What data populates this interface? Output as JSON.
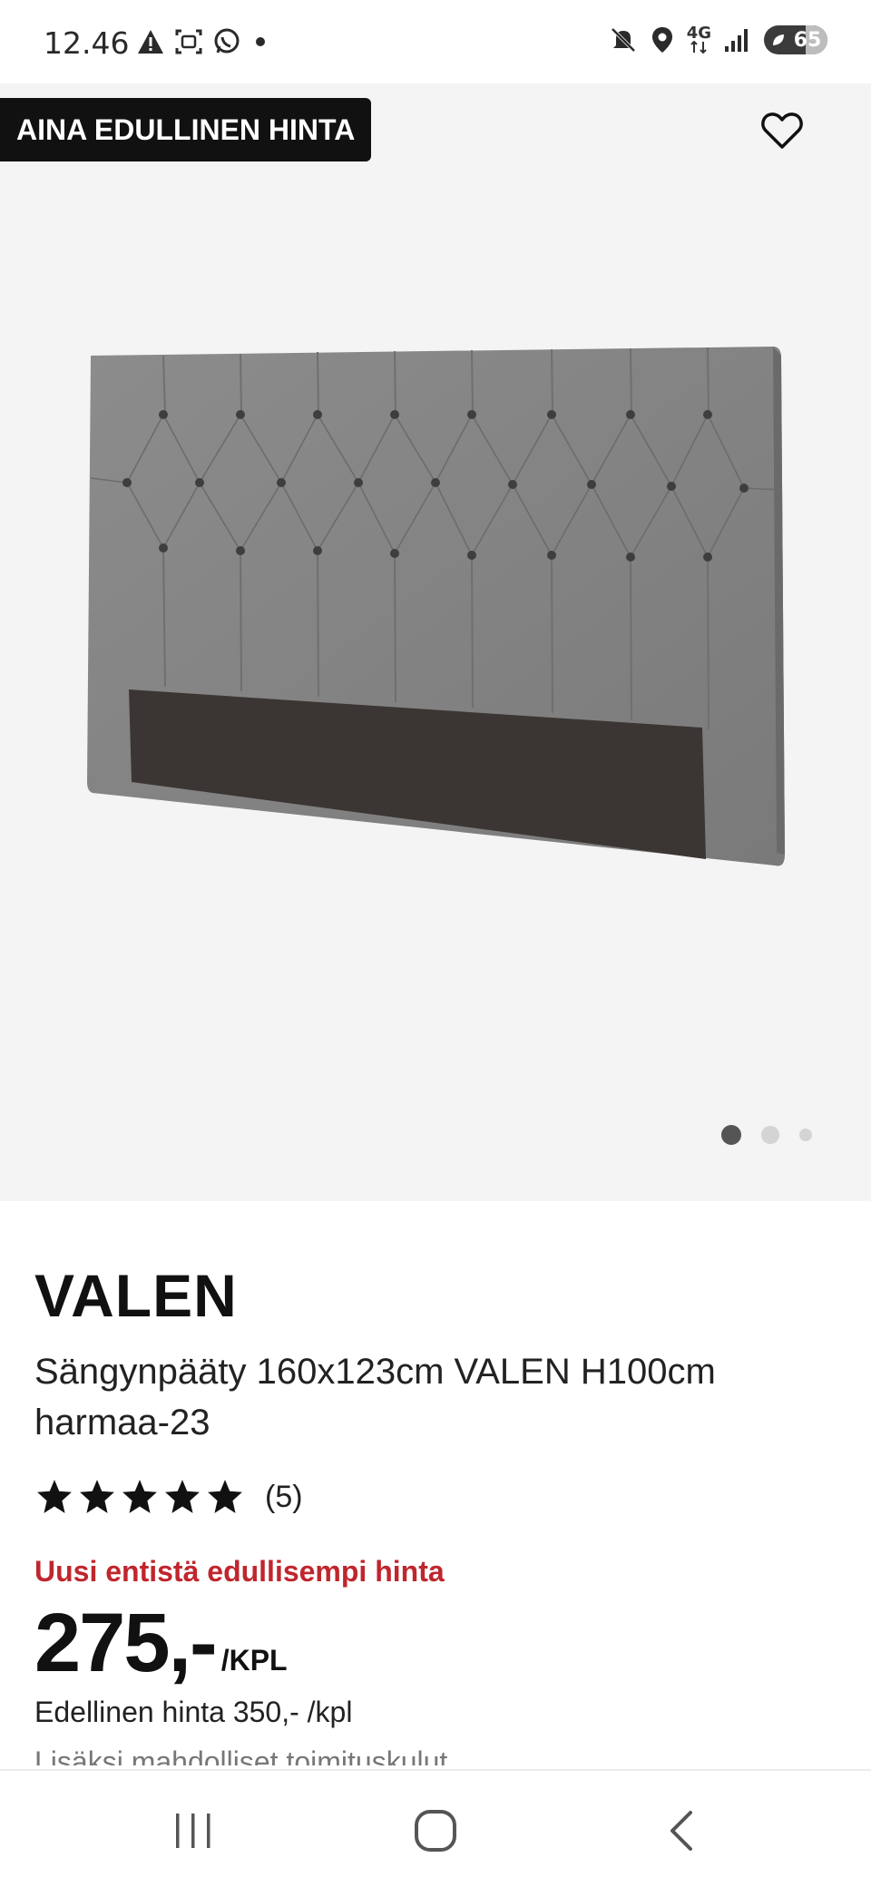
{
  "status_bar": {
    "time": "12.46",
    "network_label": "4G",
    "battery_level": "65",
    "battery_fraction": 0.65,
    "left_icons": [
      "warning-icon",
      "screenshot-icon",
      "whatsapp-icon",
      "dot-icon"
    ],
    "right_icons": [
      "mute-icon",
      "location-icon",
      "network-icon",
      "signal-icon",
      "battery-icon"
    ]
  },
  "gallery": {
    "badge": "AINA EDULLINEN HINTA",
    "image_count": 3,
    "active_index": 0
  },
  "product": {
    "brand": "VALEN",
    "description": "Sängynpääty 160x123cm VALEN H100cm harmaa-23",
    "rating": 5,
    "review_count": "(5)",
    "promo": "Uusi entistä edullisempi hinta",
    "price": "275,-",
    "unit": "/KPL",
    "previous_price": "Edellinen hinta 350,- /kpl",
    "delivery_note": "Lisäksi mahdolliset toimituskulut"
  },
  "colors": {
    "promo": "#c0262d",
    "badge_bg": "#111111",
    "gallery_bg": "#f4f4f4"
  },
  "nav": [
    "recent-apps-icon",
    "home-icon",
    "back-icon"
  ]
}
